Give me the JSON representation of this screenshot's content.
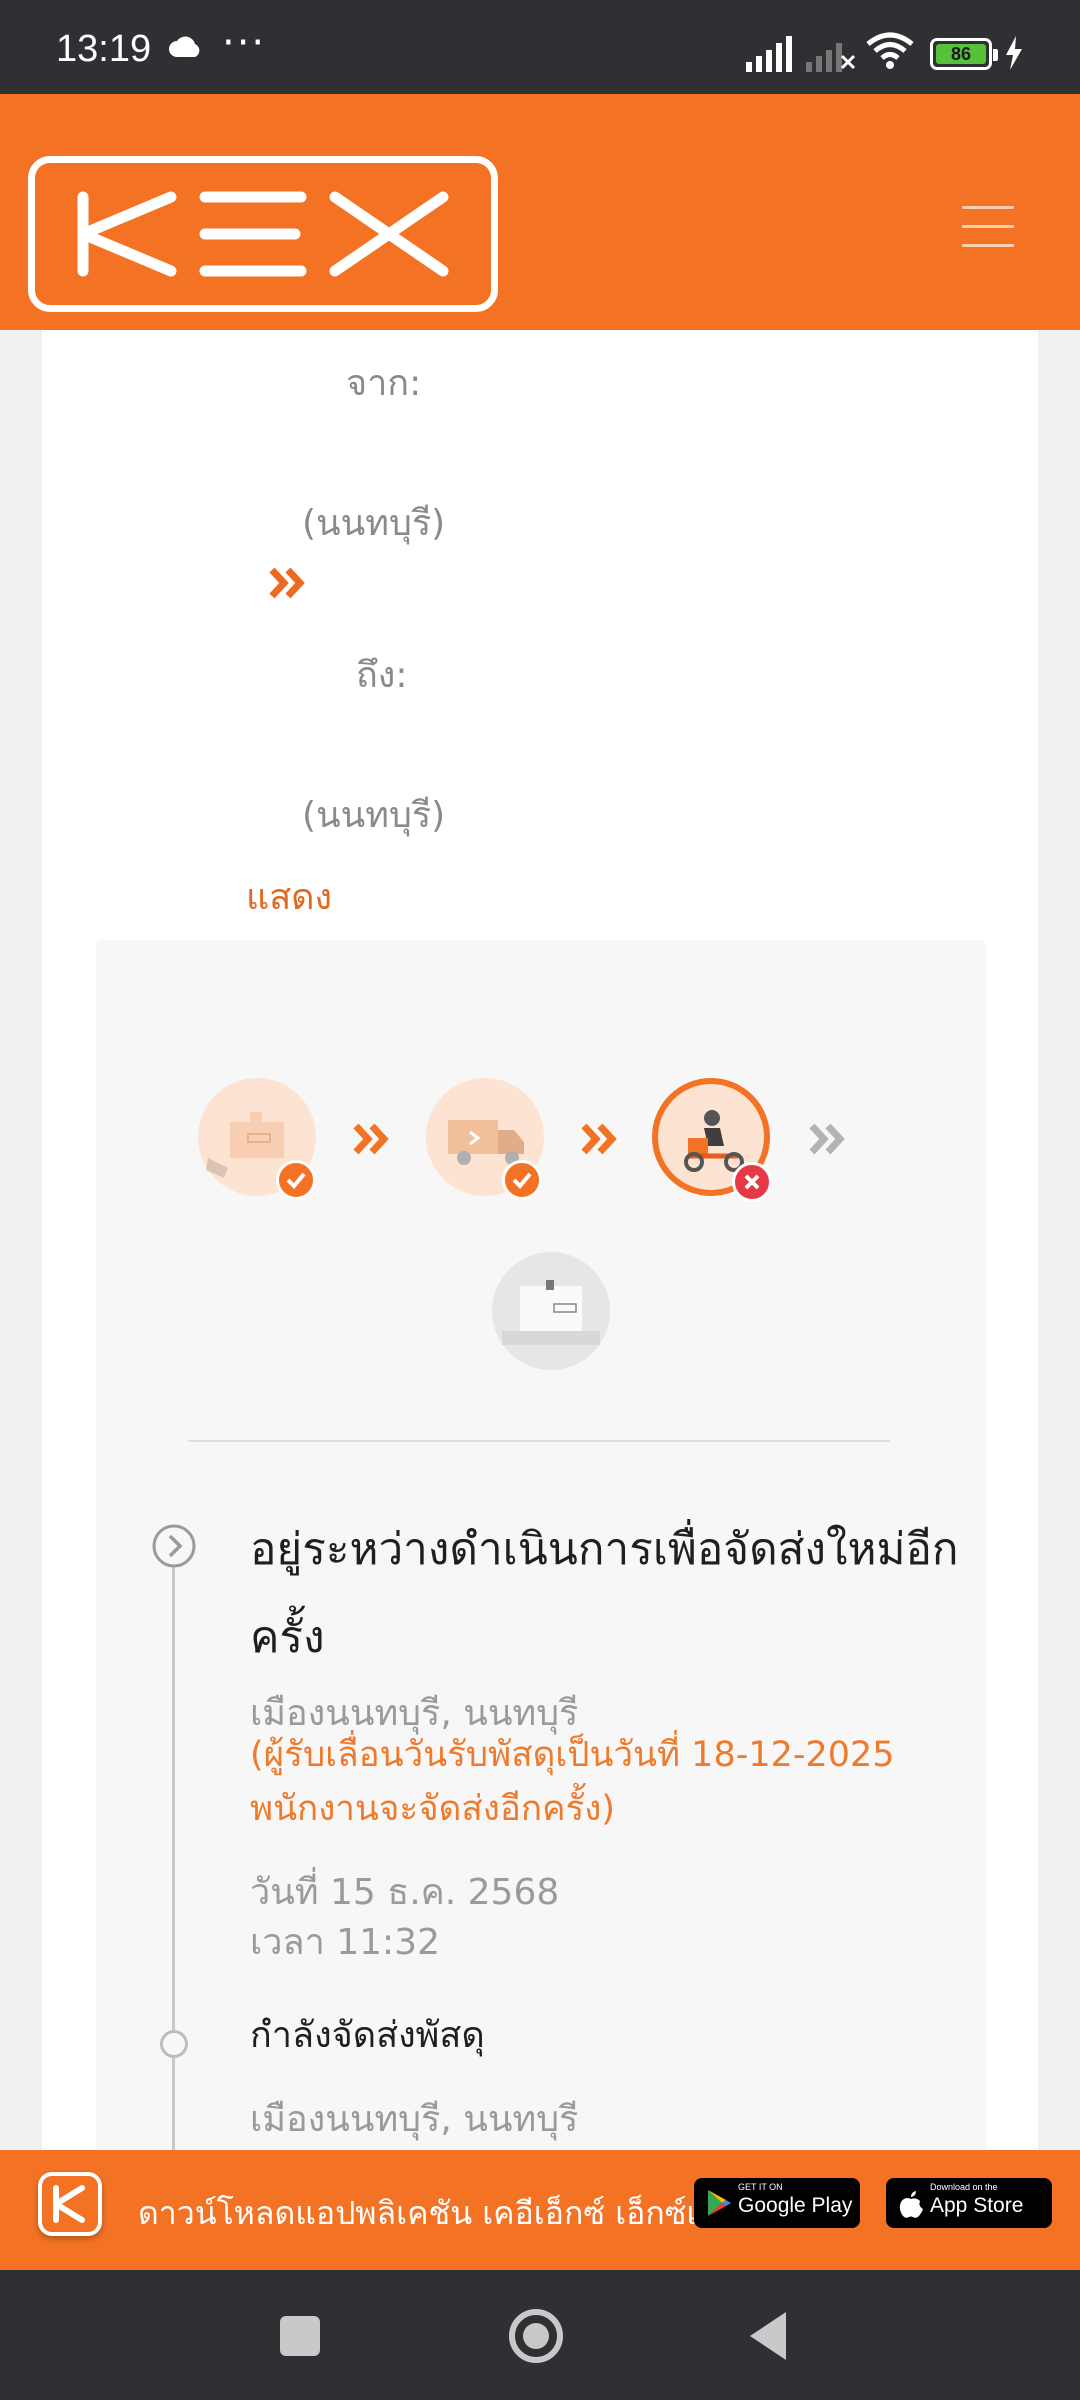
{
  "status_bar": {
    "time": "13:19",
    "battery": "86",
    "icons": [
      "cloud-icon",
      "more-dots-icon",
      "signal-icon",
      "signal-no-sim-icon",
      "wifi-icon",
      "battery-icon",
      "charging-icon"
    ]
  },
  "header": {
    "logo": "KEX",
    "menu_icon": "hamburger-menu-icon",
    "brand_color": "#f37224"
  },
  "shipment": {
    "from_label": "จาก:",
    "from_province": "(นนทบุรี)",
    "to_label": "ถึง:",
    "to_province": "(นนทบุรี)",
    "show_link": "แสดง"
  },
  "progress_steps": [
    {
      "icon": "parcel-pickup-icon",
      "status": "done"
    },
    {
      "icon": "truck-icon",
      "status": "done"
    },
    {
      "icon": "delivery-scooter-icon",
      "status": "failed"
    },
    {
      "icon": "delivered-box-icon",
      "status": "pending"
    }
  ],
  "timeline": [
    {
      "title_line1": "อยู่ระหว่างดำเนินการเพื่อจัดส่งใหม่อีก",
      "title_line2": "ครั้ง",
      "location": "เมืองนนทบุรี, นนทบุรี",
      "note_line1": "(ผู้รับเลื่อนวันรับพัสดุเป็นวันที่ 18-12-2025",
      "note_line2": "พนักงานจะจัดส่งอีกครั้ง)",
      "date": "วันที่ 15 ธ.ค. 2568",
      "time": "เวลา 11:32"
    },
    {
      "title": "กำลังจัดส่งพัสดุ",
      "location": "เมืองนนทบุรี, นนทบุรี"
    }
  ],
  "banner": {
    "text": "ดาวน์โหลดแอปพลิเคชัน เคอีเอ็กซ์ เอ็กซ์เพรส",
    "google_small": "GET IT ON",
    "google_big": "Google Play",
    "apple_small": "Download on the",
    "apple_big": "App Store"
  },
  "nav": {
    "recents": "recents-square-icon",
    "home": "home-circle-icon",
    "back": "back-triangle-icon"
  }
}
